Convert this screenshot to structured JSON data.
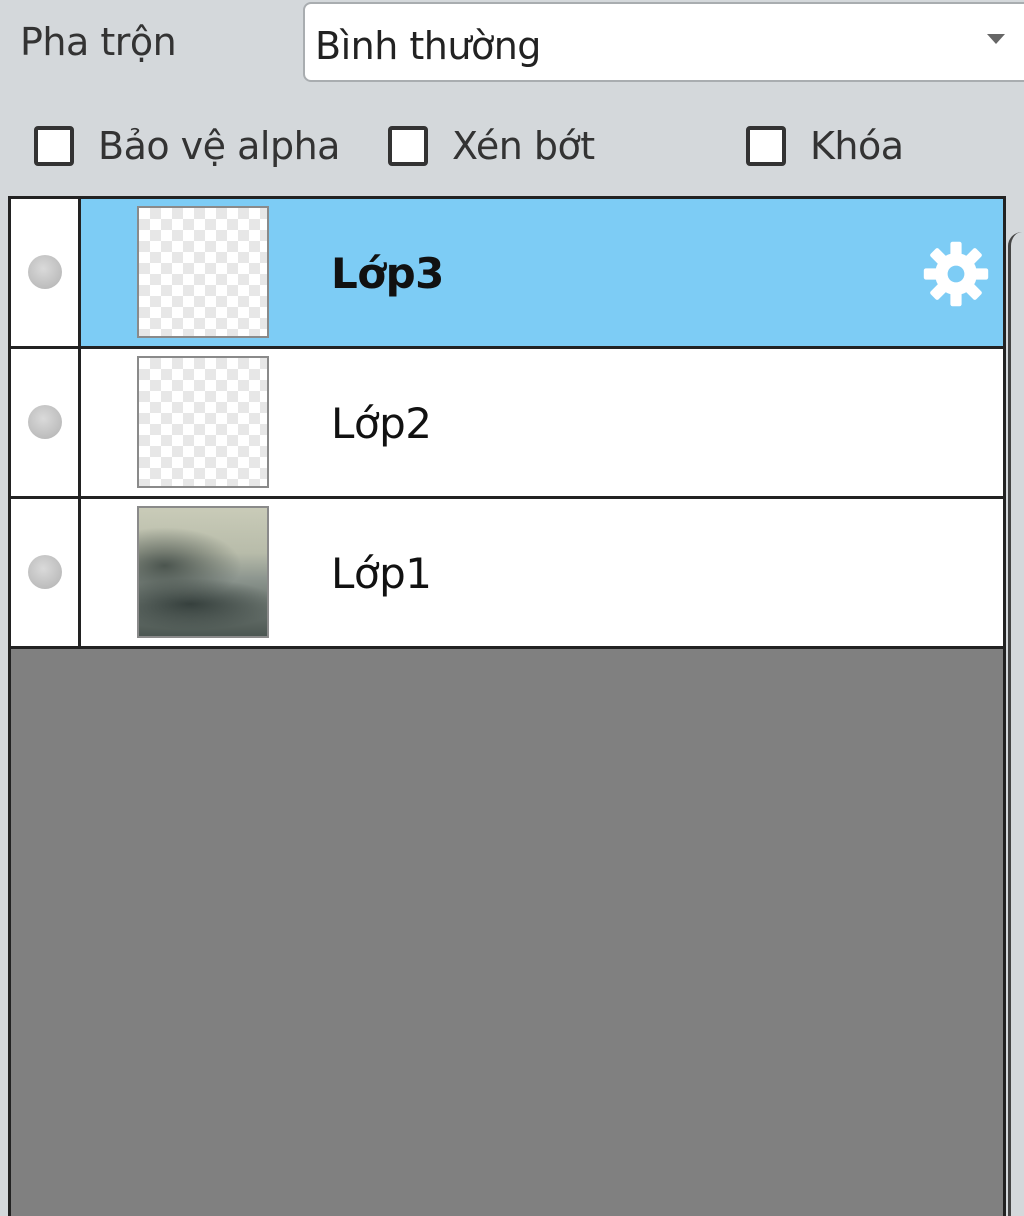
{
  "blend": {
    "label": "Pha trộn",
    "value": "Bình thường"
  },
  "options": {
    "protect_alpha": {
      "label": "Bảo vệ alpha",
      "checked": false
    },
    "clip": {
      "label": "Xén bớt",
      "checked": false
    },
    "lock": {
      "label": "Khóa",
      "checked": false
    }
  },
  "layers": [
    {
      "name": "Lớp3",
      "selected": true,
      "visible": false,
      "thumbnail": "transparent"
    },
    {
      "name": "Lớp2",
      "selected": false,
      "visible": false,
      "thumbnail": "transparent"
    },
    {
      "name": "Lớp1",
      "selected": false,
      "visible": false,
      "thumbnail": "foggy-landscape-photo"
    }
  ],
  "colors": {
    "selected_row": "#7dccf5",
    "panel_bg": "#d4d8db",
    "list_empty_bg": "#808080"
  },
  "icons": {
    "settings": "gear-icon",
    "visibility": "visibility-dot-icon"
  }
}
